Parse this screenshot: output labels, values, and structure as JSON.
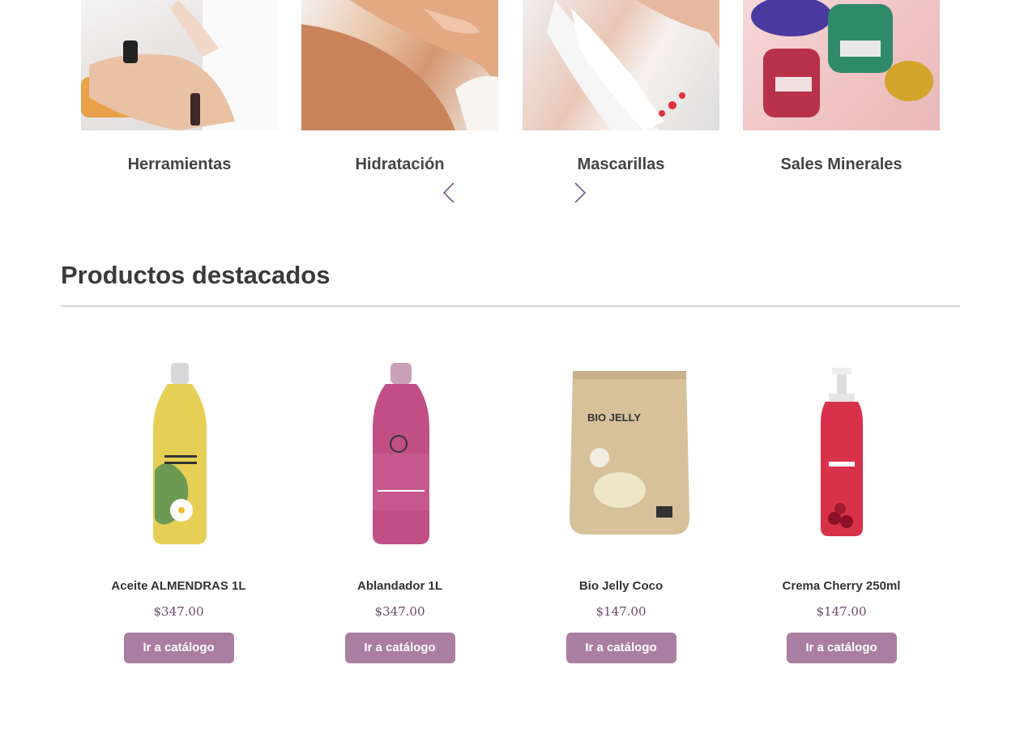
{
  "categories": [
    {
      "label": "Herramientas"
    },
    {
      "label": "Hidratación"
    },
    {
      "label": "Mascarillas"
    },
    {
      "label": "Sales Minerales"
    }
  ],
  "carousel": {
    "prev_icon": "chevron-left-icon",
    "next_icon": "chevron-right-icon"
  },
  "section": {
    "title": "Productos destacados"
  },
  "products": [
    {
      "name": "Aceite ALMENDRAS 1L",
      "price": "$347.00",
      "button": "Ir a catálogo"
    },
    {
      "name": "Ablandador 1L",
      "price": "$347.00",
      "button": "Ir a catálogo"
    },
    {
      "name": "Bio Jelly Coco",
      "price": "$147.00",
      "button": "Ir a catálogo"
    },
    {
      "name": "Crema Cherry 250ml",
      "price": "$147.00",
      "button": "Ir a catálogo"
    }
  ],
  "colors": {
    "button_bg": "#a97ea1",
    "price": "#6a4a6a",
    "rule": "#d6d6d6"
  }
}
